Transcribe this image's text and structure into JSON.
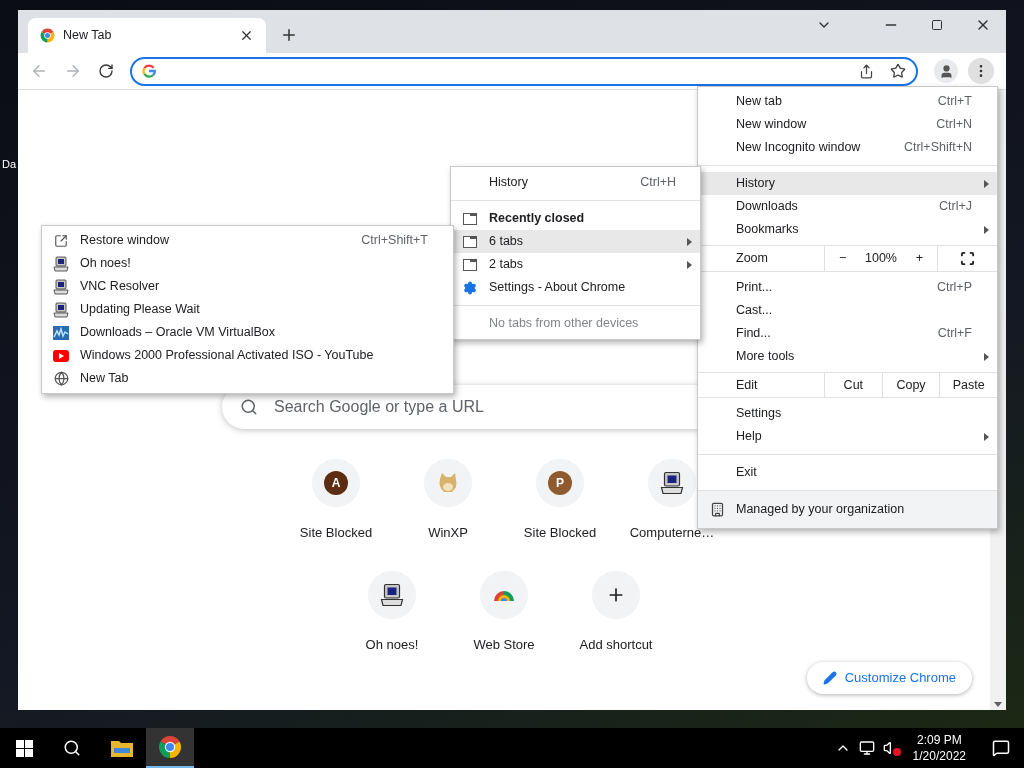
{
  "desktop": {
    "icon_labels": [
      "Da"
    ]
  },
  "tabs": [
    {
      "title": "New Tab",
      "selected": true
    }
  ],
  "new_tab_page": {
    "search": {
      "placeholder": "Search Google or type a URL"
    },
    "shortcuts": [
      {
        "label": "Site Blocked",
        "kind": "letter",
        "letter": "A",
        "color": "#5c2d12"
      },
      {
        "label": "WinXP",
        "kind": "dog"
      },
      {
        "label": "Site Blocked",
        "kind": "letter",
        "letter": "P",
        "color": "#8e5a2e"
      },
      {
        "label": "Computerne…",
        "kind": "computer"
      },
      {
        "label": "Oh noes!",
        "kind": "computer"
      },
      {
        "label": "Web Store",
        "kind": "webstore"
      },
      {
        "label": "Add shortcut",
        "kind": "add"
      }
    ],
    "customize_button": "Customize Chrome"
  },
  "main_menu": {
    "sections": [
      [
        {
          "kind": "item",
          "label": "New tab",
          "shortcut": "Ctrl+T",
          "submenu": false,
          "selected": false
        },
        {
          "kind": "item",
          "label": "New window",
          "shortcut": "Ctrl+N",
          "submenu": false,
          "selected": false
        },
        {
          "kind": "item",
          "label": "New Incognito window",
          "shortcut": "Ctrl+Shift+N",
          "submenu": false,
          "selected": false
        }
      ],
      [
        {
          "kind": "item",
          "label": "History",
          "submenu": true,
          "selected": true
        },
        {
          "kind": "item",
          "label": "Downloads",
          "shortcut": "Ctrl+J",
          "submenu": false,
          "selected": false
        },
        {
          "kind": "item",
          "label": "Bookmarks",
          "submenu": true,
          "selected": false
        }
      ],
      [
        {
          "kind": "zoom",
          "label": "Zoom",
          "minus": "−",
          "value": "100%",
          "plus": "+"
        }
      ],
      [
        {
          "kind": "item",
          "label": "Print...",
          "shortcut": "Ctrl+P",
          "submenu": false,
          "selected": false
        },
        {
          "kind": "item",
          "label": "Cast...",
          "submenu": false,
          "selected": false
        },
        {
          "kind": "item",
          "label": "Find...",
          "shortcut": "Ctrl+F",
          "submenu": false,
          "selected": false
        },
        {
          "kind": "item",
          "label": "More tools",
          "submenu": true,
          "selected": false
        }
      ],
      [
        {
          "kind": "edit",
          "label": "Edit",
          "actions": [
            "Cut",
            "Copy",
            "Paste"
          ]
        }
      ],
      [
        {
          "kind": "item",
          "label": "Settings",
          "submenu": false,
          "selected": false
        },
        {
          "kind": "item",
          "label": "Help",
          "submenu": true,
          "selected": false
        }
      ],
      [
        {
          "kind": "item",
          "label": "Exit",
          "submenu": false,
          "selected": false
        }
      ],
      [
        {
          "kind": "managed",
          "label": "Managed by your organization"
        }
      ]
    ]
  },
  "history_menu": {
    "sections": [
      [
        {
          "kind": "item",
          "label": "History",
          "shortcut": "Ctrl+H",
          "submenu": false,
          "selected": false
        }
      ],
      [
        {
          "kind": "header",
          "label": "Recently closed"
        },
        {
          "kind": "window",
          "label": "6 tabs",
          "submenu": true,
          "selected": true
        },
        {
          "kind": "window",
          "label": "2 tabs",
          "submenu": true,
          "selected": false
        },
        {
          "kind": "settings",
          "label": "Settings - About Chrome",
          "submenu": false,
          "selected": false
        }
      ],
      [
        {
          "kind": "note",
          "label": "No tabs from other devices"
        }
      ]
    ]
  },
  "recent_tabs_menu": {
    "items": [
      {
        "kind": "restore",
        "label": "Restore window",
        "shortcut": "Ctrl+Shift+T"
      },
      {
        "kind": "computer",
        "label": "Oh noes!"
      },
      {
        "kind": "computer",
        "label": "VNC Resolver"
      },
      {
        "kind": "computer",
        "label": "Updating Please Wait"
      },
      {
        "kind": "virtualbox",
        "label": "Downloads – Oracle VM VirtualBox"
      },
      {
        "kind": "youtube",
        "label": "Windows 2000 Professional Activated ISO - YouTube"
      },
      {
        "kind": "globe",
        "label": "New Tab"
      }
    ]
  },
  "taskbar": {
    "apps": [
      {
        "kind": "explorer",
        "selected": false
      },
      {
        "kind": "chrome",
        "selected": true
      }
    ],
    "volume_muted": true,
    "time": "2:09 PM",
    "date": "1/20/2022"
  }
}
